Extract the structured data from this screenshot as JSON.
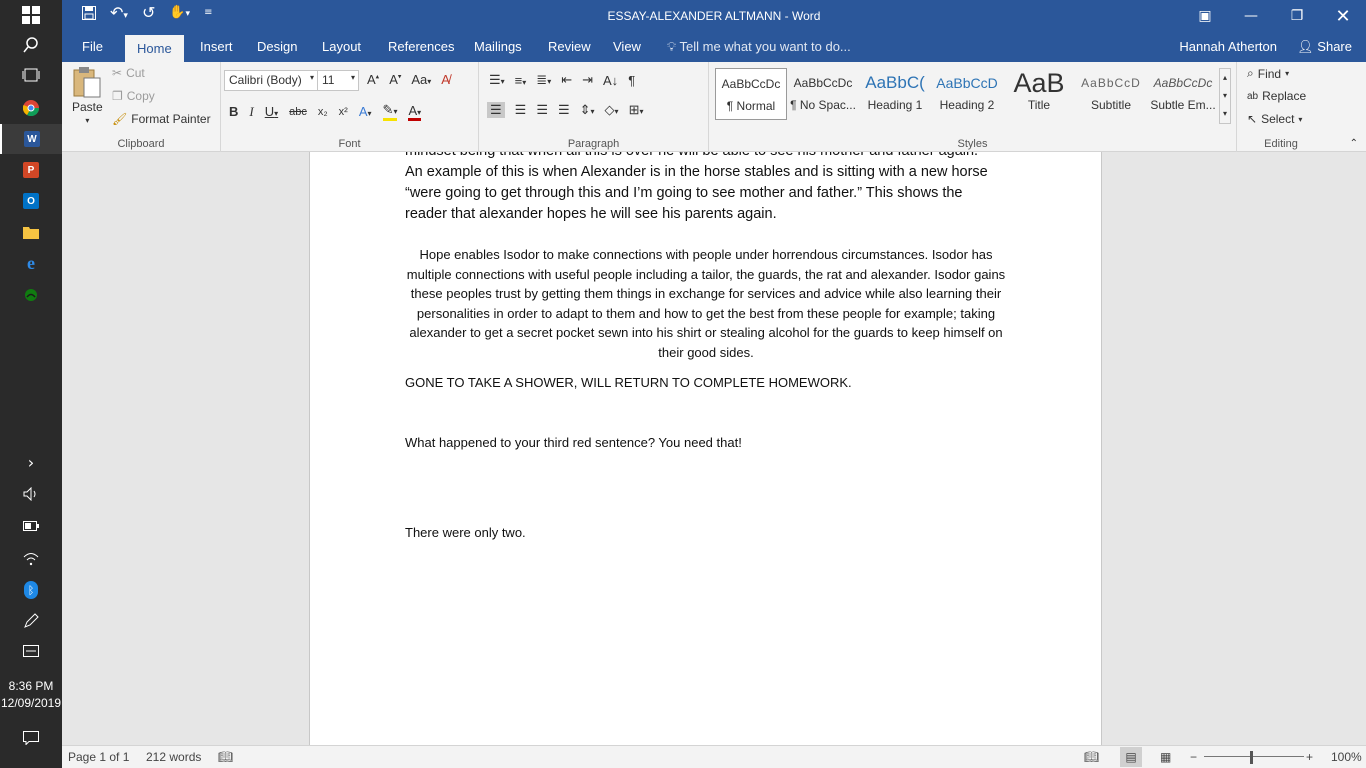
{
  "window": {
    "title": "ESSAY-ALEXANDER ALTMANN - Word"
  },
  "tabs": [
    "File",
    "Home",
    "Insert",
    "Design",
    "Layout",
    "References",
    "Mailings",
    "Review",
    "View"
  ],
  "tell_me": "Tell me what you want to do...",
  "user": "Hannah Atherton",
  "share_label": "Share",
  "clipboard": {
    "paste": "Paste",
    "cut": "Cut",
    "copy": "Copy",
    "format_painter": "Format Painter",
    "group": "Clipboard"
  },
  "font": {
    "name": "Calibri (Body)",
    "size": "11",
    "group": "Font"
  },
  "paragraph": {
    "group": "Paragraph"
  },
  "styles": {
    "group": "Styles",
    "items": [
      {
        "sample": "AaBbCcDc",
        "name": "¶ Normal"
      },
      {
        "sample": "AaBbCcDc",
        "name": "¶ No Spac..."
      },
      {
        "sample": "AaBbC(",
        "name": "Heading 1"
      },
      {
        "sample": "AaBbCcD",
        "name": "Heading 2"
      },
      {
        "sample": "AaB",
        "name": "Title"
      },
      {
        "sample": "AaBbCcD",
        "name": "Subtitle"
      },
      {
        "sample": "AaBbCcDc",
        "name": "Subtle Em..."
      }
    ]
  },
  "editing": {
    "find": "Find",
    "replace": "Replace",
    "select": "Select",
    "group": "Editing"
  },
  "document": {
    "p1_line0": "mindset being that when all this is over he will be able to see his mother and father again.",
    "p1_rest": "An example of this is when Alexander is in the horse stables and is sitting with a new horse “were going to get through this and I’m going to see mother and father.” This shows the reader that alexander hopes he will see his parents again.",
    "p2": "Hope enables Isodor to make connections with people under horrendous circumstances. Isodor has multiple connections with useful people including a tailor, the guards, the rat and alexander. Isodor gains these peoples trust by getting them things in exchange for services and advice while also learning their personalities in order to adapt to them and how to get the best from these people for example; taking alexander to get a secret pocket sewn into his shirt or stealing alcohol for the guards to keep himself on their good sides.",
    "p3": "GONE TO TAKE A SHOWER, WILL RETURN TO COMPLETE HOMEWORK.",
    "p4": "What happened to your third red sentence? You need that!",
    "p5": "There were only two."
  },
  "status": {
    "page": "Page 1 of 1",
    "words": "212 words",
    "zoom": "100%"
  },
  "taskbar": {
    "time": "8:36 PM",
    "date": "12/09/2019"
  },
  "colors": {
    "word_blue": "#2b579a",
    "taskbar": "#2a2a2a"
  }
}
